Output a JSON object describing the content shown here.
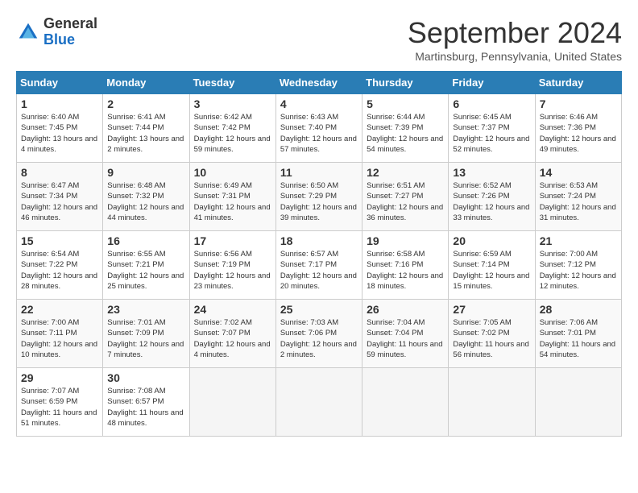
{
  "logo": {
    "line1": "General",
    "line2": "Blue"
  },
  "title": "September 2024",
  "location": "Martinsburg, Pennsylvania, United States",
  "days_of_week": [
    "Sunday",
    "Monday",
    "Tuesday",
    "Wednesday",
    "Thursday",
    "Friday",
    "Saturday"
  ],
  "weeks": [
    [
      {
        "day": "1",
        "sunrise": "6:40 AM",
        "sunset": "7:45 PM",
        "daylight": "13 hours and 4 minutes."
      },
      {
        "day": "2",
        "sunrise": "6:41 AM",
        "sunset": "7:44 PM",
        "daylight": "13 hours and 2 minutes."
      },
      {
        "day": "3",
        "sunrise": "6:42 AM",
        "sunset": "7:42 PM",
        "daylight": "12 hours and 59 minutes."
      },
      {
        "day": "4",
        "sunrise": "6:43 AM",
        "sunset": "7:40 PM",
        "daylight": "12 hours and 57 minutes."
      },
      {
        "day": "5",
        "sunrise": "6:44 AM",
        "sunset": "7:39 PM",
        "daylight": "12 hours and 54 minutes."
      },
      {
        "day": "6",
        "sunrise": "6:45 AM",
        "sunset": "7:37 PM",
        "daylight": "12 hours and 52 minutes."
      },
      {
        "day": "7",
        "sunrise": "6:46 AM",
        "sunset": "7:36 PM",
        "daylight": "12 hours and 49 minutes."
      }
    ],
    [
      {
        "day": "8",
        "sunrise": "6:47 AM",
        "sunset": "7:34 PM",
        "daylight": "12 hours and 46 minutes."
      },
      {
        "day": "9",
        "sunrise": "6:48 AM",
        "sunset": "7:32 PM",
        "daylight": "12 hours and 44 minutes."
      },
      {
        "day": "10",
        "sunrise": "6:49 AM",
        "sunset": "7:31 PM",
        "daylight": "12 hours and 41 minutes."
      },
      {
        "day": "11",
        "sunrise": "6:50 AM",
        "sunset": "7:29 PM",
        "daylight": "12 hours and 39 minutes."
      },
      {
        "day": "12",
        "sunrise": "6:51 AM",
        "sunset": "7:27 PM",
        "daylight": "12 hours and 36 minutes."
      },
      {
        "day": "13",
        "sunrise": "6:52 AM",
        "sunset": "7:26 PM",
        "daylight": "12 hours and 33 minutes."
      },
      {
        "day": "14",
        "sunrise": "6:53 AM",
        "sunset": "7:24 PM",
        "daylight": "12 hours and 31 minutes."
      }
    ],
    [
      {
        "day": "15",
        "sunrise": "6:54 AM",
        "sunset": "7:22 PM",
        "daylight": "12 hours and 28 minutes."
      },
      {
        "day": "16",
        "sunrise": "6:55 AM",
        "sunset": "7:21 PM",
        "daylight": "12 hours and 25 minutes."
      },
      {
        "day": "17",
        "sunrise": "6:56 AM",
        "sunset": "7:19 PM",
        "daylight": "12 hours and 23 minutes."
      },
      {
        "day": "18",
        "sunrise": "6:57 AM",
        "sunset": "7:17 PM",
        "daylight": "12 hours and 20 minutes."
      },
      {
        "day": "19",
        "sunrise": "6:58 AM",
        "sunset": "7:16 PM",
        "daylight": "12 hours and 18 minutes."
      },
      {
        "day": "20",
        "sunrise": "6:59 AM",
        "sunset": "7:14 PM",
        "daylight": "12 hours and 15 minutes."
      },
      {
        "day": "21",
        "sunrise": "7:00 AM",
        "sunset": "7:12 PM",
        "daylight": "12 hours and 12 minutes."
      }
    ],
    [
      {
        "day": "22",
        "sunrise": "7:00 AM",
        "sunset": "7:11 PM",
        "daylight": "12 hours and 10 minutes."
      },
      {
        "day": "23",
        "sunrise": "7:01 AM",
        "sunset": "7:09 PM",
        "daylight": "12 hours and 7 minutes."
      },
      {
        "day": "24",
        "sunrise": "7:02 AM",
        "sunset": "7:07 PM",
        "daylight": "12 hours and 4 minutes."
      },
      {
        "day": "25",
        "sunrise": "7:03 AM",
        "sunset": "7:06 PM",
        "daylight": "12 hours and 2 minutes."
      },
      {
        "day": "26",
        "sunrise": "7:04 AM",
        "sunset": "7:04 PM",
        "daylight": "11 hours and 59 minutes."
      },
      {
        "day": "27",
        "sunrise": "7:05 AM",
        "sunset": "7:02 PM",
        "daylight": "11 hours and 56 minutes."
      },
      {
        "day": "28",
        "sunrise": "7:06 AM",
        "sunset": "7:01 PM",
        "daylight": "11 hours and 54 minutes."
      }
    ],
    [
      {
        "day": "29",
        "sunrise": "7:07 AM",
        "sunset": "6:59 PM",
        "daylight": "11 hours and 51 minutes."
      },
      {
        "day": "30",
        "sunrise": "7:08 AM",
        "sunset": "6:57 PM",
        "daylight": "11 hours and 48 minutes."
      },
      null,
      null,
      null,
      null,
      null
    ]
  ]
}
